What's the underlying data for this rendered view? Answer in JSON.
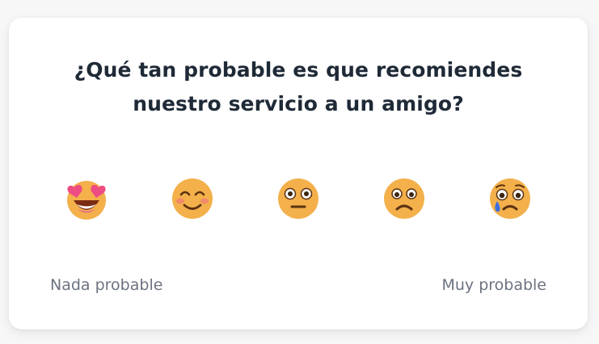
{
  "survey": {
    "question": "¿Qué tan probable es que recomiendes nuestro servicio a un amigo?",
    "options": [
      {
        "icon": "heart-eyes-face-icon"
      },
      {
        "icon": "smiling-blush-face-icon"
      },
      {
        "icon": "neutral-face-icon"
      },
      {
        "icon": "frowning-face-icon"
      },
      {
        "icon": "sad-tear-face-icon"
      }
    ],
    "label_left": "Nada probable",
    "label_right": "Muy probable"
  },
  "colors": {
    "face": "#f3b04b",
    "text_primary": "#1f2a37",
    "text_secondary": "#6b7280",
    "heart": "#ee4d83",
    "tear": "#3b6fe0"
  }
}
